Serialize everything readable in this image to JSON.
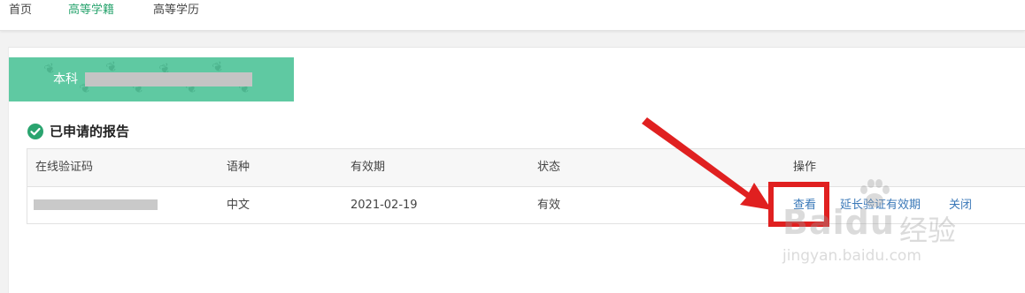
{
  "nav": {
    "items": [
      {
        "label": "首页"
      },
      {
        "label": "高等学籍"
      },
      {
        "label": "高等学历"
      }
    ],
    "active_index": 1
  },
  "degree_tab": {
    "label": "本科"
  },
  "section": {
    "title": "已申请的报告"
  },
  "table": {
    "headers": [
      "在线验证码",
      "语种",
      "有效期",
      "状态",
      "操作"
    ],
    "rows": [
      {
        "language": "中文",
        "expiry": "2021-02-19",
        "status": "有效",
        "actions": [
          "查看",
          "延长验证有效期",
          "关闭"
        ]
      }
    ]
  },
  "watermark": {
    "logo": "Baidu",
    "logo_cn": "经验",
    "url": "jingyan.baidu.com"
  },
  "colors": {
    "accent_green": "#2aa46f",
    "tab_green": "#5fc9a2",
    "link_blue": "#3a78b8",
    "highlight_red": "#e02020"
  }
}
